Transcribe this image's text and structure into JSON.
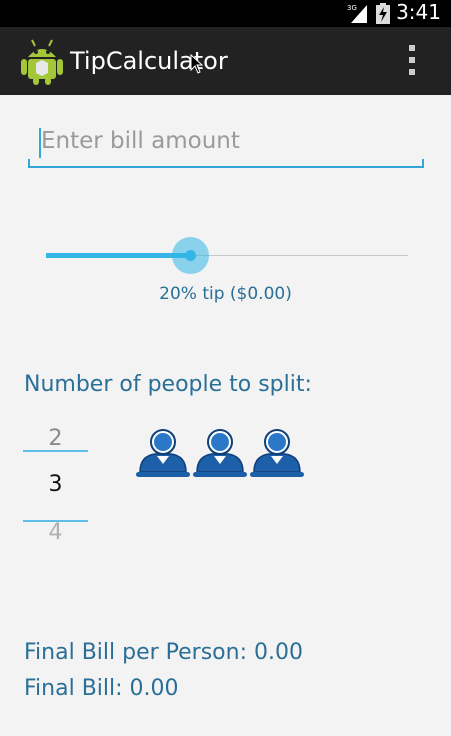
{
  "status_bar": {
    "time": "3:41",
    "network_label": "3G"
  },
  "app_bar": {
    "title": "TipCalculator"
  },
  "bill_input": {
    "placeholder": "Enter bill amount"
  },
  "tip_slider": {
    "percent": 20,
    "label": "20% tip ($0.00)",
    "max_percent": 40
  },
  "split": {
    "title": "Number of people to split:",
    "picker_prev": "2",
    "picker_current": "3",
    "picker_next": "4",
    "people_count": 3
  },
  "results": {
    "per_person": "Final Bill per Person: 0.00",
    "total": "Final Bill: 0.00"
  },
  "colors": {
    "accent": "#33b5e5",
    "text_blue": "#2a6f97",
    "action_bar": "#222222"
  }
}
